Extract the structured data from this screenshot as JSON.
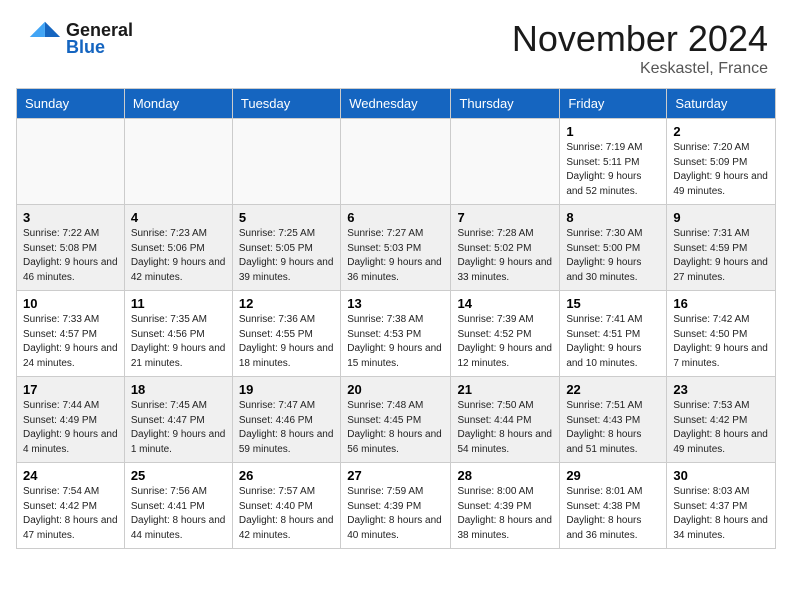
{
  "header": {
    "logo_line1": "General",
    "logo_line2": "Blue",
    "month": "November 2024",
    "location": "Keskastel, France"
  },
  "days_of_week": [
    "Sunday",
    "Monday",
    "Tuesday",
    "Wednesday",
    "Thursday",
    "Friday",
    "Saturday"
  ],
  "weeks": [
    [
      {
        "day": "",
        "info": ""
      },
      {
        "day": "",
        "info": ""
      },
      {
        "day": "",
        "info": ""
      },
      {
        "day": "",
        "info": ""
      },
      {
        "day": "",
        "info": ""
      },
      {
        "day": "1",
        "info": "Sunrise: 7:19 AM\nSunset: 5:11 PM\nDaylight: 9 hours\nand 52 minutes."
      },
      {
        "day": "2",
        "info": "Sunrise: 7:20 AM\nSunset: 5:09 PM\nDaylight: 9 hours\nand 49 minutes."
      }
    ],
    [
      {
        "day": "3",
        "info": "Sunrise: 7:22 AM\nSunset: 5:08 PM\nDaylight: 9 hours\nand 46 minutes."
      },
      {
        "day": "4",
        "info": "Sunrise: 7:23 AM\nSunset: 5:06 PM\nDaylight: 9 hours\nand 42 minutes."
      },
      {
        "day": "5",
        "info": "Sunrise: 7:25 AM\nSunset: 5:05 PM\nDaylight: 9 hours\nand 39 minutes."
      },
      {
        "day": "6",
        "info": "Sunrise: 7:27 AM\nSunset: 5:03 PM\nDaylight: 9 hours\nand 36 minutes."
      },
      {
        "day": "7",
        "info": "Sunrise: 7:28 AM\nSunset: 5:02 PM\nDaylight: 9 hours\nand 33 minutes."
      },
      {
        "day": "8",
        "info": "Sunrise: 7:30 AM\nSunset: 5:00 PM\nDaylight: 9 hours\nand 30 minutes."
      },
      {
        "day": "9",
        "info": "Sunrise: 7:31 AM\nSunset: 4:59 PM\nDaylight: 9 hours\nand 27 minutes."
      }
    ],
    [
      {
        "day": "10",
        "info": "Sunrise: 7:33 AM\nSunset: 4:57 PM\nDaylight: 9 hours\nand 24 minutes."
      },
      {
        "day": "11",
        "info": "Sunrise: 7:35 AM\nSunset: 4:56 PM\nDaylight: 9 hours\nand 21 minutes."
      },
      {
        "day": "12",
        "info": "Sunrise: 7:36 AM\nSunset: 4:55 PM\nDaylight: 9 hours\nand 18 minutes."
      },
      {
        "day": "13",
        "info": "Sunrise: 7:38 AM\nSunset: 4:53 PM\nDaylight: 9 hours\nand 15 minutes."
      },
      {
        "day": "14",
        "info": "Sunrise: 7:39 AM\nSunset: 4:52 PM\nDaylight: 9 hours\nand 12 minutes."
      },
      {
        "day": "15",
        "info": "Sunrise: 7:41 AM\nSunset: 4:51 PM\nDaylight: 9 hours\nand 10 minutes."
      },
      {
        "day": "16",
        "info": "Sunrise: 7:42 AM\nSunset: 4:50 PM\nDaylight: 9 hours\nand 7 minutes."
      }
    ],
    [
      {
        "day": "17",
        "info": "Sunrise: 7:44 AM\nSunset: 4:49 PM\nDaylight: 9 hours\nand 4 minutes."
      },
      {
        "day": "18",
        "info": "Sunrise: 7:45 AM\nSunset: 4:47 PM\nDaylight: 9 hours\nand 1 minute."
      },
      {
        "day": "19",
        "info": "Sunrise: 7:47 AM\nSunset: 4:46 PM\nDaylight: 8 hours\nand 59 minutes."
      },
      {
        "day": "20",
        "info": "Sunrise: 7:48 AM\nSunset: 4:45 PM\nDaylight: 8 hours\nand 56 minutes."
      },
      {
        "day": "21",
        "info": "Sunrise: 7:50 AM\nSunset: 4:44 PM\nDaylight: 8 hours\nand 54 minutes."
      },
      {
        "day": "22",
        "info": "Sunrise: 7:51 AM\nSunset: 4:43 PM\nDaylight: 8 hours\nand 51 minutes."
      },
      {
        "day": "23",
        "info": "Sunrise: 7:53 AM\nSunset: 4:42 PM\nDaylight: 8 hours\nand 49 minutes."
      }
    ],
    [
      {
        "day": "24",
        "info": "Sunrise: 7:54 AM\nSunset: 4:42 PM\nDaylight: 8 hours\nand 47 minutes."
      },
      {
        "day": "25",
        "info": "Sunrise: 7:56 AM\nSunset: 4:41 PM\nDaylight: 8 hours\nand 44 minutes."
      },
      {
        "day": "26",
        "info": "Sunrise: 7:57 AM\nSunset: 4:40 PM\nDaylight: 8 hours\nand 42 minutes."
      },
      {
        "day": "27",
        "info": "Sunrise: 7:59 AM\nSunset: 4:39 PM\nDaylight: 8 hours\nand 40 minutes."
      },
      {
        "day": "28",
        "info": "Sunrise: 8:00 AM\nSunset: 4:39 PM\nDaylight: 8 hours\nand 38 minutes."
      },
      {
        "day": "29",
        "info": "Sunrise: 8:01 AM\nSunset: 4:38 PM\nDaylight: 8 hours\nand 36 minutes."
      },
      {
        "day": "30",
        "info": "Sunrise: 8:03 AM\nSunset: 4:37 PM\nDaylight: 8 hours\nand 34 minutes."
      }
    ]
  ]
}
